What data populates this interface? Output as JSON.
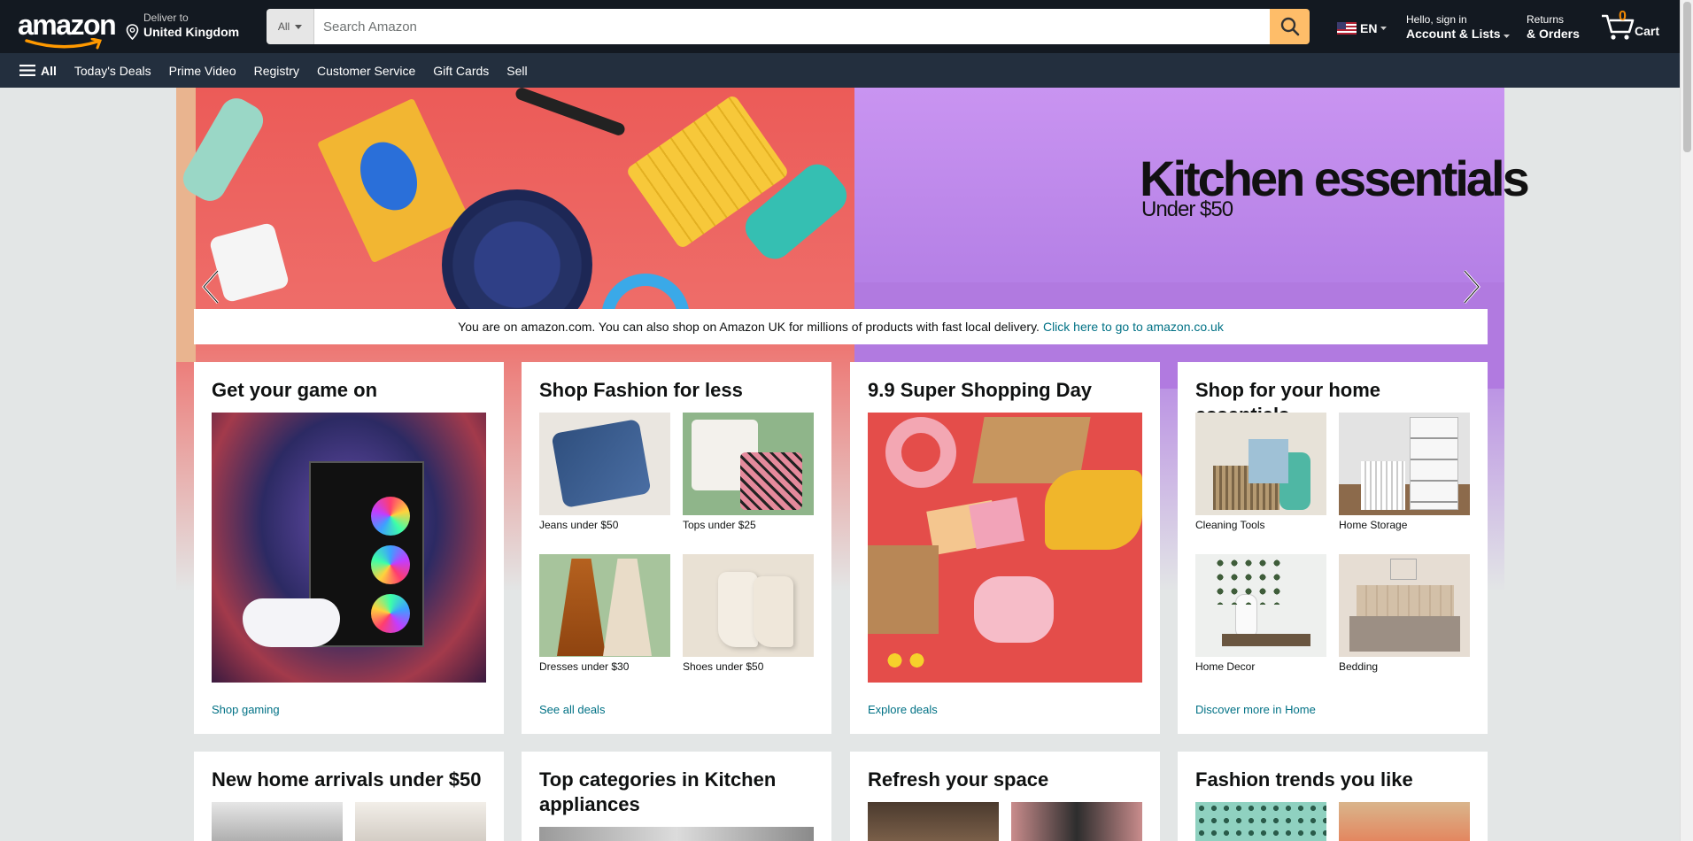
{
  "header": {
    "logo_text": "amazon",
    "deliver": {
      "line1": "Deliver to",
      "line2": "United Kingdom"
    },
    "search": {
      "category": "All",
      "placeholder": "Search Amazon"
    },
    "language": "EN",
    "account": {
      "line1": "Hello, sign in",
      "line2": "Account & Lists"
    },
    "returns": {
      "line1": "Returns",
      "line2": "& Orders"
    },
    "cart": {
      "count": "0",
      "label": "Cart"
    }
  },
  "subnav": {
    "all_label": "All",
    "items": [
      "Today's Deals",
      "Prime Video",
      "Registry",
      "Customer Service",
      "Gift Cards",
      "Sell"
    ]
  },
  "hero": {
    "title": "Kitchen essentials",
    "subtitle": "Under $50"
  },
  "notice": {
    "text": "You are on amazon.com. You can also shop on Amazon UK for millions of products with fast local delivery.",
    "link": "Click here to go to amazon.co.uk"
  },
  "cards": [
    {
      "title": "Get your game on",
      "link": "Shop gaming"
    },
    {
      "title": "Shop Fashion for less",
      "link": "See all deals",
      "tiles": [
        "Jeans under $50",
        "Tops under $25",
        "Dresses under $30",
        "Shoes under $50"
      ]
    },
    {
      "title": "9.9 Super Shopping Day",
      "link": "Explore deals"
    },
    {
      "title": "Shop for your home essentials",
      "link": "Discover more in Home",
      "tiles": [
        "Cleaning Tools",
        "Home Storage",
        "Home Decor",
        "Bedding"
      ]
    }
  ],
  "cards_row2": [
    {
      "title": "New home arrivals under $50"
    },
    {
      "title": "Top categories in Kitchen appliances"
    },
    {
      "title": "Refresh your space"
    },
    {
      "title": "Fashion trends you like"
    }
  ],
  "colors": {
    "nav_bg": "#131921",
    "subnav_bg": "#232f3e",
    "search_button": "#febd69",
    "link": "#007185",
    "cart_count": "#f08804"
  }
}
